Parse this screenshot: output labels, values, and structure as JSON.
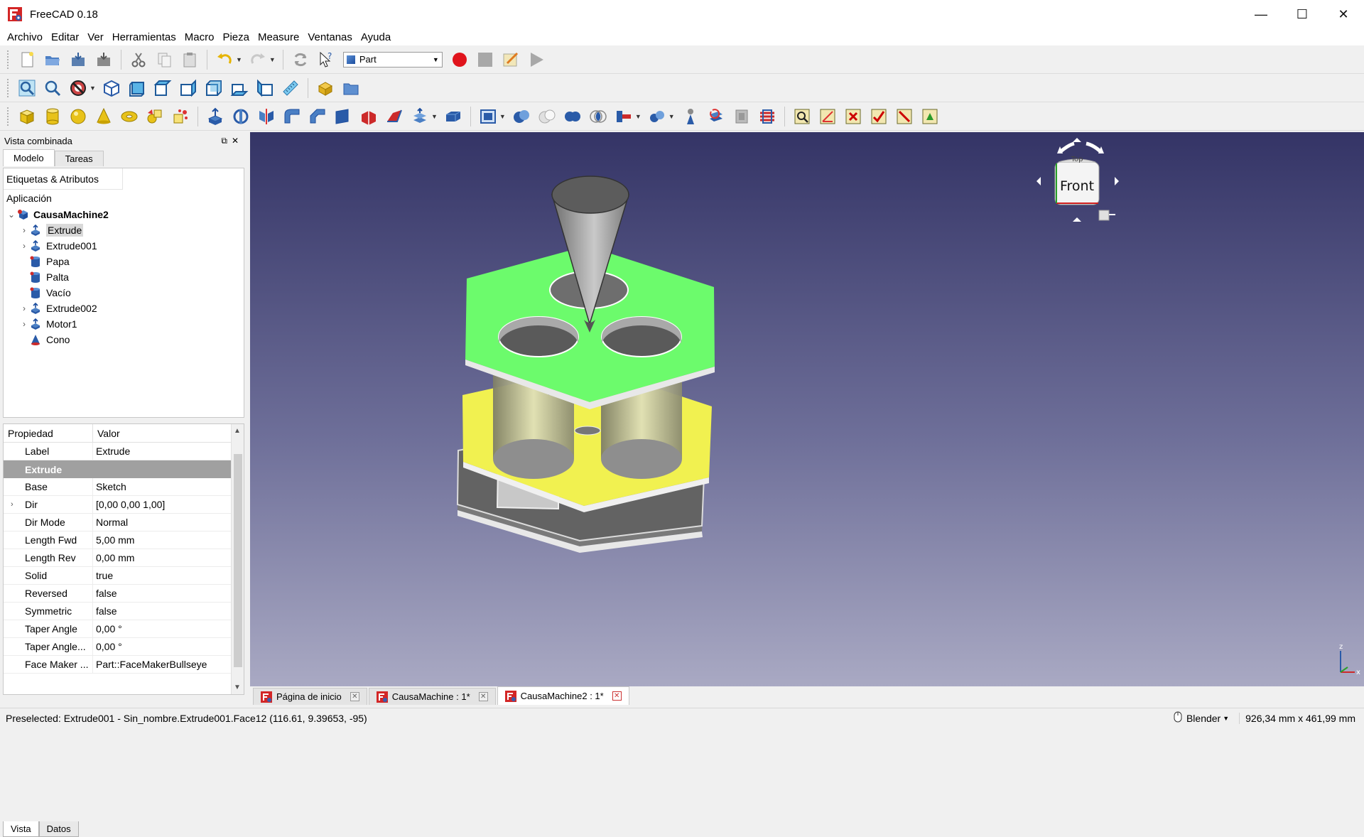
{
  "window": {
    "title": "FreeCAD 0.18",
    "controls": [
      "—",
      "☐",
      "✕"
    ]
  },
  "menu": [
    "Archivo",
    "Editar",
    "Ver",
    "Herramientas",
    "Macro",
    "Pieza",
    "Measure",
    "Ventanas",
    "Ayuda"
  ],
  "toolbar": {
    "workbench": "Part"
  },
  "combo": {
    "title": "Vista combinada",
    "tabs": [
      "Modelo",
      "Tareas"
    ],
    "tree_header": "Etiquetas & Atributos",
    "app_label": "Aplicación",
    "root": "CausaMachine2",
    "items": [
      {
        "label": "Extrude",
        "type": "extrude",
        "expandable": true
      },
      {
        "label": "Extrude001",
        "type": "extrude",
        "expandable": true
      },
      {
        "label": "Papa",
        "type": "cylinder",
        "expandable": false
      },
      {
        "label": "Palta",
        "type": "cylinder",
        "expandable": false
      },
      {
        "label": "Vacío",
        "type": "cylinder",
        "expandable": false
      },
      {
        "label": "Extrude002",
        "type": "extrude",
        "expandable": true
      },
      {
        "label": "Motor1",
        "type": "extrude",
        "expandable": true
      },
      {
        "label": "Cono",
        "type": "cone",
        "expandable": false
      }
    ],
    "props_header": {
      "property": "Propiedad",
      "value": "Valor"
    },
    "props_top": {
      "key": "Label",
      "value": "Extrude"
    },
    "props_group": "Extrude",
    "props": [
      {
        "key": "Base",
        "value": "Sketch",
        "exp": false
      },
      {
        "key": "Dir",
        "value": "[0,00 0,00 1,00]",
        "exp": true
      },
      {
        "key": "Dir Mode",
        "value": "Normal",
        "exp": false
      },
      {
        "key": "Length Fwd",
        "value": "5,00 mm",
        "exp": false
      },
      {
        "key": "Length Rev",
        "value": "0,00 mm",
        "exp": false
      },
      {
        "key": "Solid",
        "value": "true",
        "exp": false
      },
      {
        "key": "Reversed",
        "value": "false",
        "exp": false
      },
      {
        "key": "Symmetric",
        "value": "false",
        "exp": false
      },
      {
        "key": "Taper Angle",
        "value": "0,00 °",
        "exp": false
      },
      {
        "key": "Taper Angle...",
        "value": "0,00 °",
        "exp": false
      },
      {
        "key": "Face Maker ...",
        "value": "Part::FaceMakerBullseye",
        "exp": false
      }
    ],
    "bottom_tabs": [
      "Vista",
      "Datos"
    ]
  },
  "navcube": {
    "face": "Front",
    "top_face": "Top"
  },
  "axis": {
    "z": "z",
    "x": "x"
  },
  "doc_tabs": [
    {
      "label": "Página de inicio",
      "active": false
    },
    {
      "label": "CausaMachine : 1*",
      "active": false
    },
    {
      "label": "CausaMachine2 : 1*",
      "active": true
    }
  ],
  "status": {
    "message": "Preselected: Extrude001 - Sin_nombre.Extrude001.Face12 (116.61, 9.39653, -95)",
    "nav_style": "Blender",
    "dimensions": "926,34 mm x 461,99 mm"
  },
  "colors": {
    "accent_green": "#6cff6c",
    "accent_yellow": "#f4f453",
    "record_red": "#e0141c",
    "viewport_top": "#343466",
    "viewport_bottom": "#a9a9c3"
  }
}
